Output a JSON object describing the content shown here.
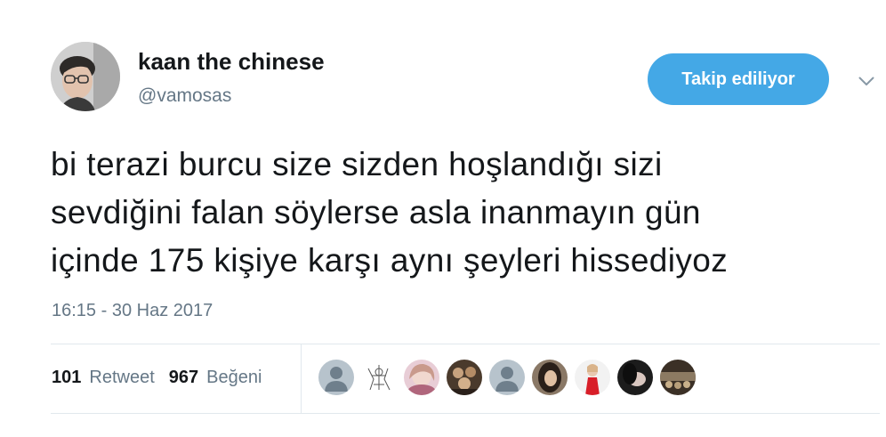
{
  "user": {
    "display_name": "kaan the chinese",
    "handle": "@vamosas",
    "avatar_icon": "profile-photo"
  },
  "follow_button_label": "Takip ediliyor",
  "menu_icon": "chevron-down-icon",
  "tweet": {
    "lines": [
      "bi terazi burcu size sizden hoşlandığı sizi",
      "sevdiğini falan söylerse asla inanmayın gün",
      "içinde 175 kişiye karşı aynı şeyleri hissediyoz"
    ],
    "timestamp": "16:15 - 30 Haz 2017"
  },
  "stats": {
    "retweets_count": "101",
    "retweets_label": "Retweet",
    "likes_count": "967",
    "likes_label": "Beğeni"
  },
  "colors": {
    "accent": "#44a8e6",
    "secondary_text": "#657786",
    "divider": "#e1e8ed"
  }
}
